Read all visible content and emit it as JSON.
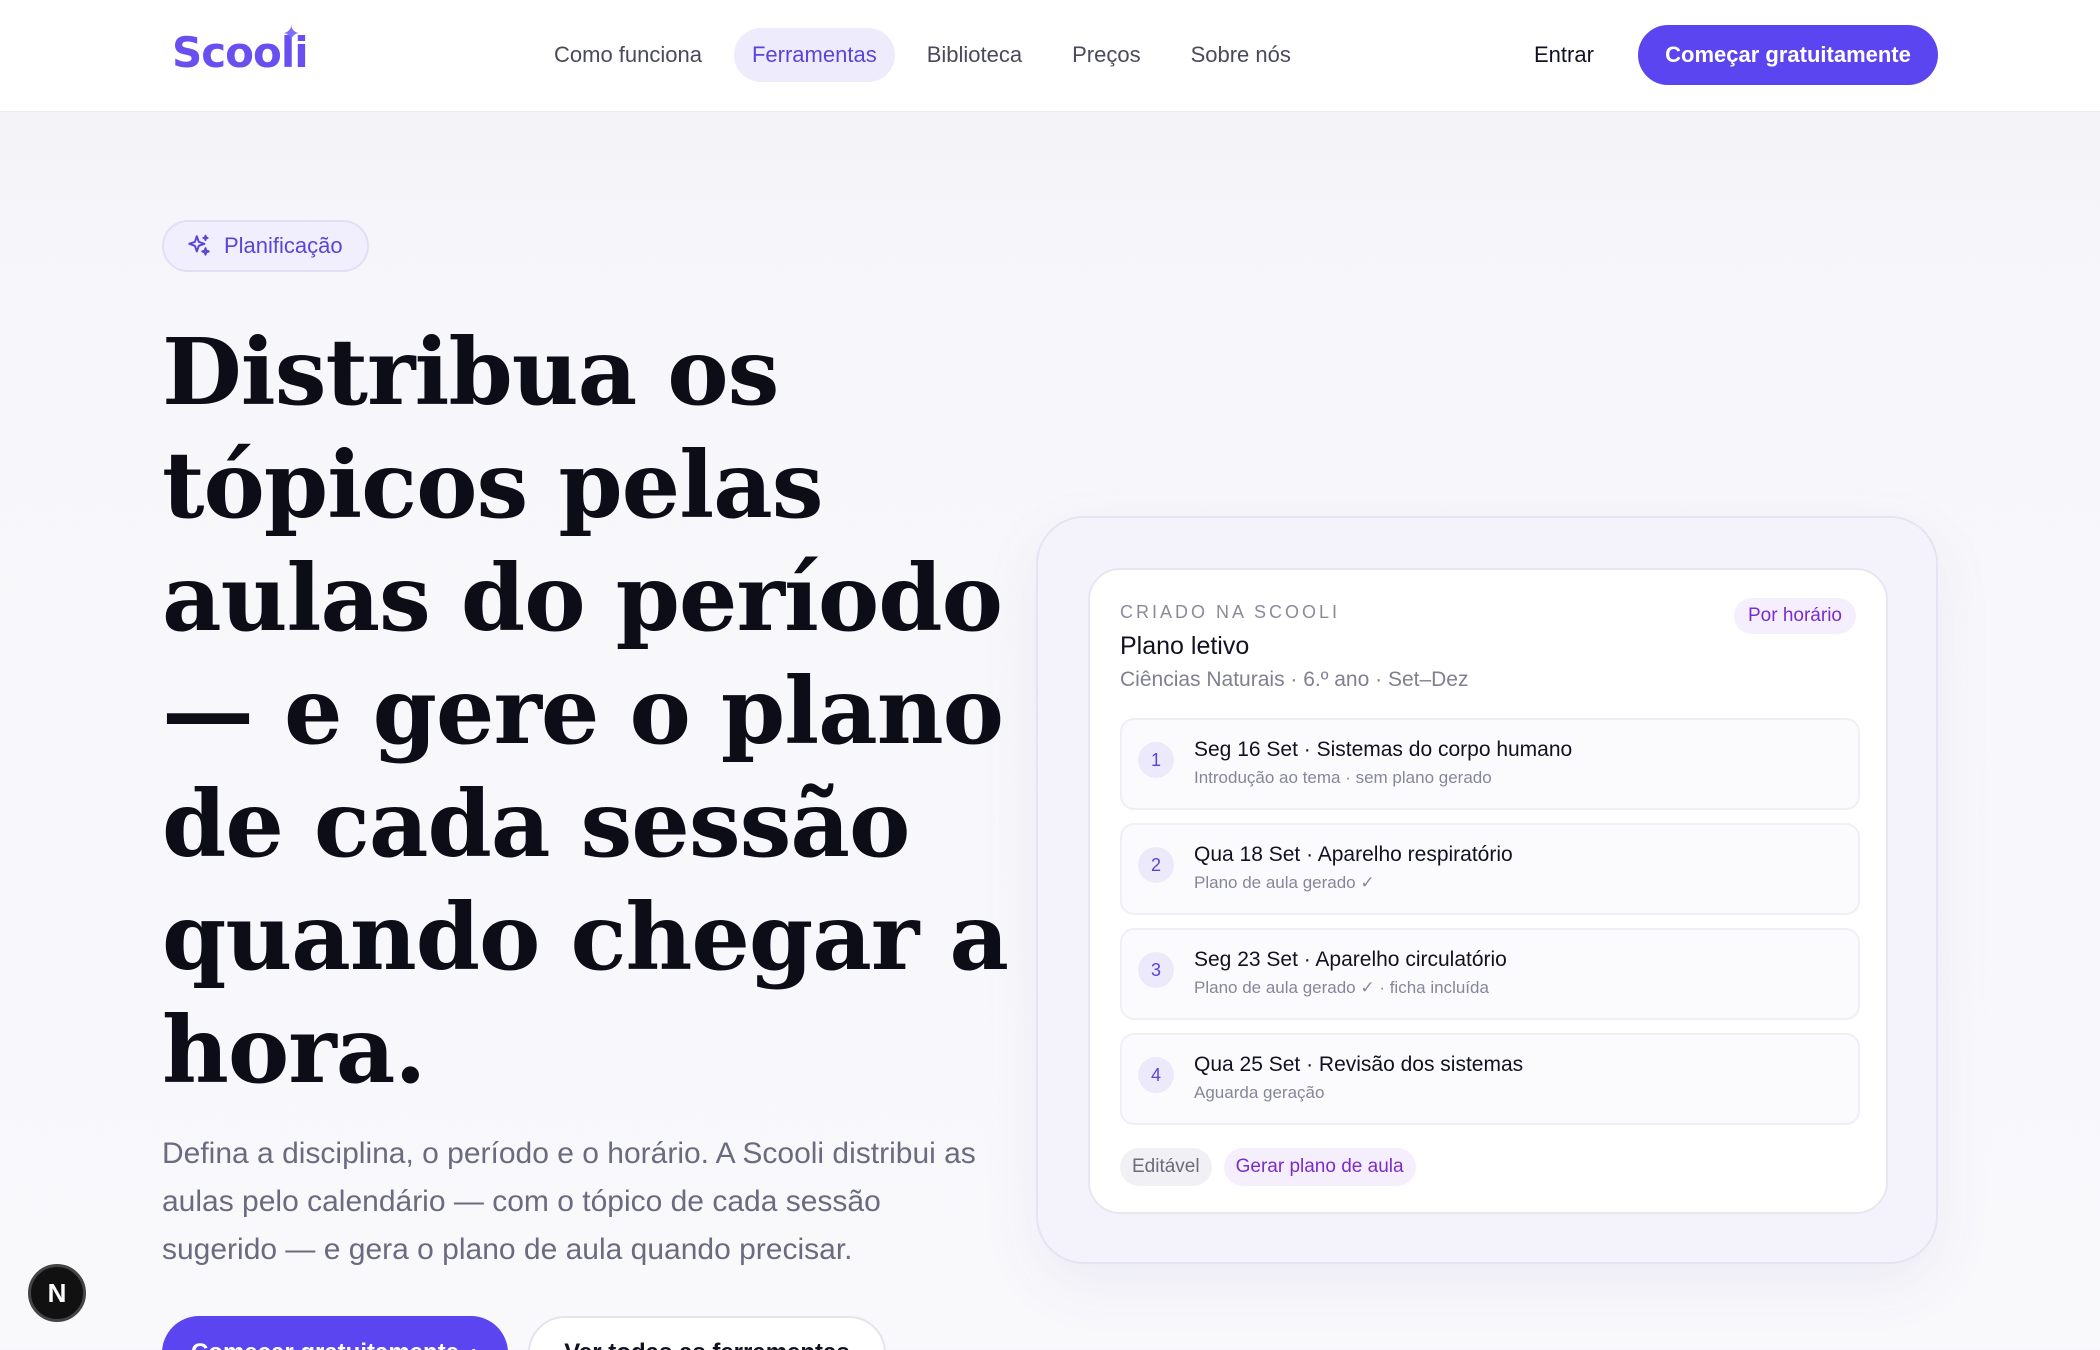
{
  "nav": {
    "logo": "Scooli",
    "links": [
      {
        "label": "Como funciona"
      },
      {
        "label": "Ferramentas"
      },
      {
        "label": "Biblioteca"
      },
      {
        "label": "Preços"
      },
      {
        "label": "Sobre nós"
      }
    ],
    "active_link": "Ferramentas",
    "signin_label": "Entrar",
    "cta_label": "Começar gratuitamente"
  },
  "hero": {
    "pill_label": "Planificação",
    "title": "Distribua os tópicos pelas aulas do período — e gere o plano de cada sessão quando chegar a hora.",
    "subtitle": "Defina a disciplina, o período e o horário. A Scooli distribui as aulas pelo calendário — com o tópico de cada sessão sugerido — e gera o plano de aula quando precisar.",
    "primary_button": "Começar gratuitamente",
    "secondary_button": "Ver todas as ferramentas"
  },
  "card": {
    "eyebrow": "Criado na Scooli",
    "badge": "Por horário",
    "title": "Plano letivo",
    "subtitle": "Ciências Naturais · 6.º ano · Set–Dez",
    "rows": [
      {
        "num": "1",
        "title": "Seg 16 Set · Sistemas do corpo humano",
        "meta": "Introdução ao tema · sem plano gerado"
      },
      {
        "num": "2",
        "title": "Qua 18 Set · Aparelho respiratório",
        "meta": "Plano de aula gerado ✓"
      },
      {
        "num": "3",
        "title": "Seg 23 Set · Aparelho circulatório",
        "meta": "Plano de aula gerado ✓ · ficha incluída"
      },
      {
        "num": "4",
        "title": "Qua 25 Set · Revisão dos sistemas",
        "meta": "Aguarda geração"
      }
    ],
    "tags": {
      "editable": "Editável",
      "generate": "Gerar plano de aula"
    }
  },
  "floating_badge": "N",
  "colors": {
    "accent": "#5b45f0",
    "accent_soft": "#eeebfd",
    "tag_purple": "#7a2ec8"
  }
}
